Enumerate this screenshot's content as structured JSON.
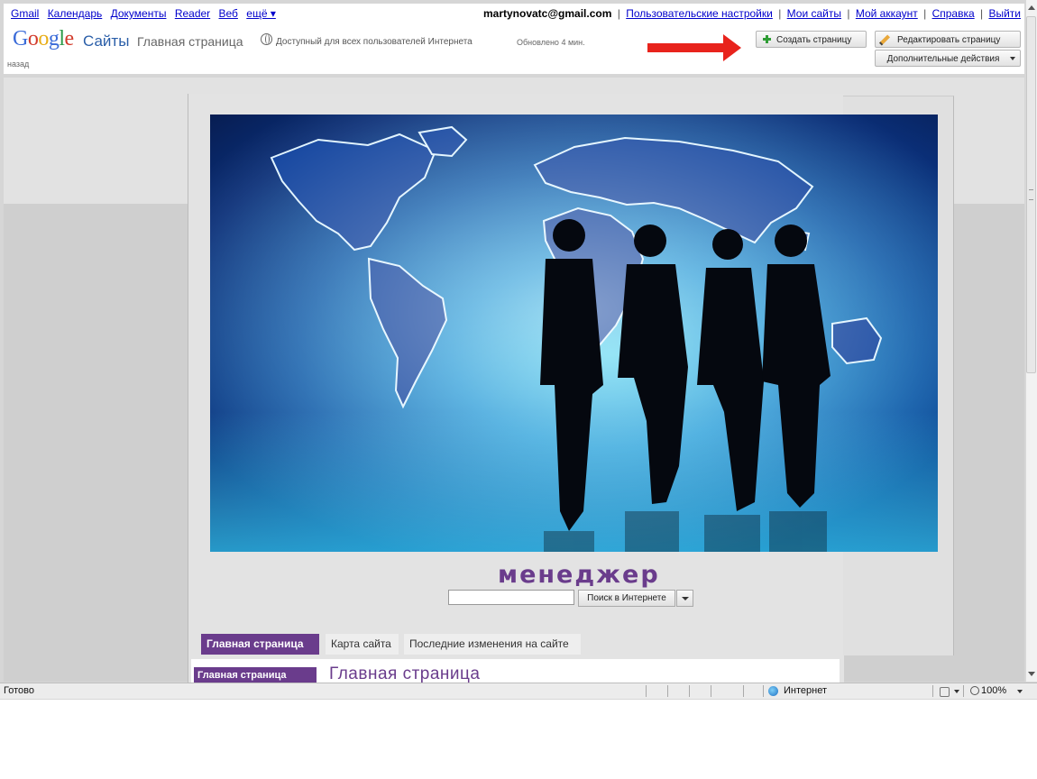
{
  "gbar": {
    "links": [
      "Gmail",
      "Календарь",
      "Документы",
      "Reader",
      "Веб",
      "ещё ▾"
    ],
    "email": "martynovatc@gmail.com",
    "account_links": [
      "Пользовательские настройки",
      "Мои сайты",
      "Мой аккаунт",
      "Справка",
      "Выйти"
    ]
  },
  "header": {
    "logo_text": "Google",
    "product": "Сайты",
    "site_title": "Главная страница",
    "access": "Доступный для всех пользователей Интернета",
    "updated": "Обновлено 4 мин.",
    "back": "назад",
    "create_button": "Создать страницу",
    "edit_button": "Редактировать страницу",
    "more_button": "Дополнительные действия",
    "arrow_color": "#e8231c"
  },
  "site": {
    "name": "менеджер",
    "search_value": "",
    "search_button": "Поиск в Интернете",
    "accent": "#6a3c8c"
  },
  "nav": {
    "tabs": [
      "Главная страница",
      "Карта сайта",
      "Последние изменения на сайте"
    ],
    "active": 0
  },
  "content": {
    "sidebar_item": "Главная страница",
    "heading": "Главная страница"
  },
  "statusbar": {
    "status": "Готово",
    "zone": "Интернет",
    "zoom": "100%"
  }
}
